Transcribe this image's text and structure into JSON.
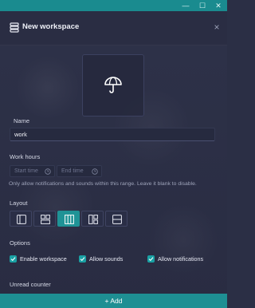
{
  "window": {
    "minimize_glyph": "—",
    "maximize_glyph": "☐",
    "close_glyph": "✕"
  },
  "header": {
    "title": "New workspace",
    "icon": "database-icon",
    "close_glyph": "×"
  },
  "icon_picker": {
    "icon": "umbrella-icon"
  },
  "name": {
    "label": "Name",
    "value": "work"
  },
  "work_hours": {
    "label": "Work hours",
    "start_placeholder": "Start time",
    "end_placeholder": "End time",
    "hint": "Only allow notifications and sounds within this range. Leave it blank to disable."
  },
  "layout": {
    "label": "Layout",
    "options": [
      {
        "icon": "layout-sidebar-icon",
        "selected": false
      },
      {
        "icon": "layout-grid-icon",
        "selected": false
      },
      {
        "icon": "layout-columns-icon",
        "selected": true
      },
      {
        "icon": "layout-split-icon",
        "selected": false
      },
      {
        "icon": "layout-rows-icon",
        "selected": false
      }
    ]
  },
  "options": {
    "label": "Options",
    "items": [
      {
        "label": "Enable workspace",
        "checked": true
      },
      {
        "label": "Allow sounds",
        "checked": true
      },
      {
        "label": "Allow notifications",
        "checked": true
      }
    ]
  },
  "unread_counter": {
    "label": "Unread counter"
  },
  "footer": {
    "add_label": "Add",
    "plus_glyph": "+"
  },
  "colors": {
    "accent": "#1f9396",
    "titlebar": "#1a8b8f",
    "background": "#2b2f45"
  }
}
